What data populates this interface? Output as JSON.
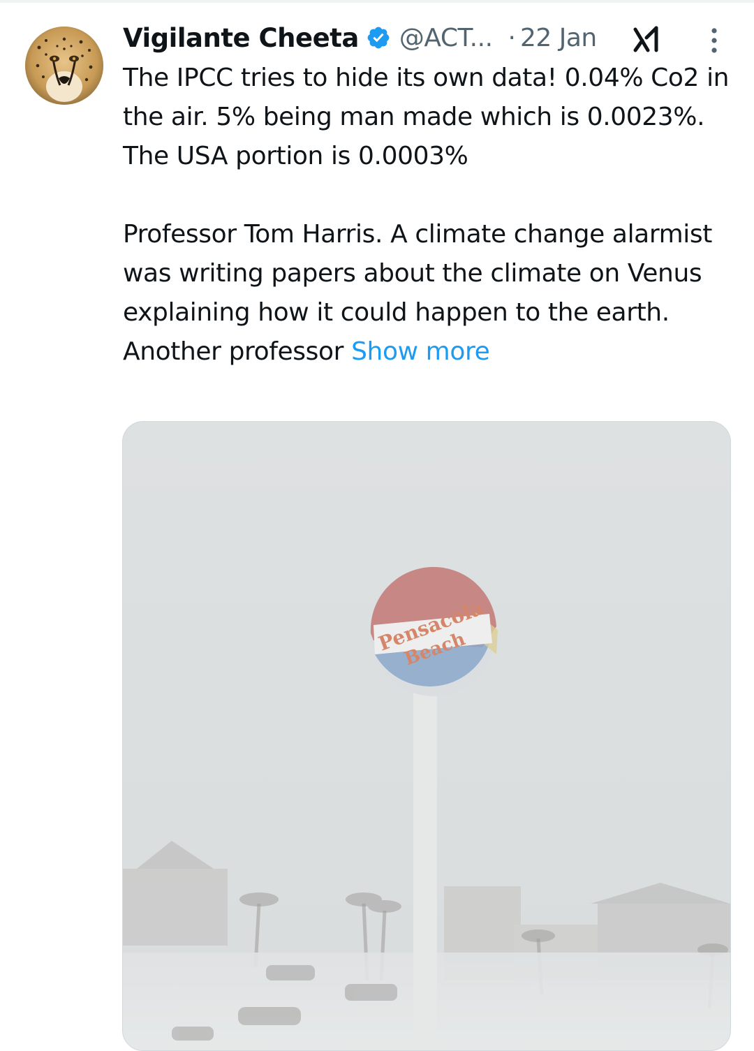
{
  "tweet": {
    "display_name": "Vigilante Cheeta",
    "handle": "@ACT...",
    "separator": "·",
    "timestamp": "22 Jan",
    "text_paragraph_1": "The IPCC tries to hide its own data! 0.04% Co2 in the air. 5% being man made which is 0.0023%. The USA portion is 0.0003%",
    "text_paragraph_2": "Professor Tom Harris. A climate change alarmist was writing papers about the climate on Venus explaining how it could happen to the earth. Another professor ",
    "show_more_label": "Show more"
  },
  "media": {
    "water_tower_text_line1": "Pensacola",
    "water_tower_text_line2": "Beach"
  },
  "icons": {
    "verified": "verified-badge-icon",
    "grok": "grok-icon",
    "more": "more-options-icon"
  },
  "colors": {
    "link_blue": "#1d9bf0",
    "secondary_text": "#536471",
    "primary_text": "#0f1419",
    "verified_blue": "#1d9bf0"
  }
}
